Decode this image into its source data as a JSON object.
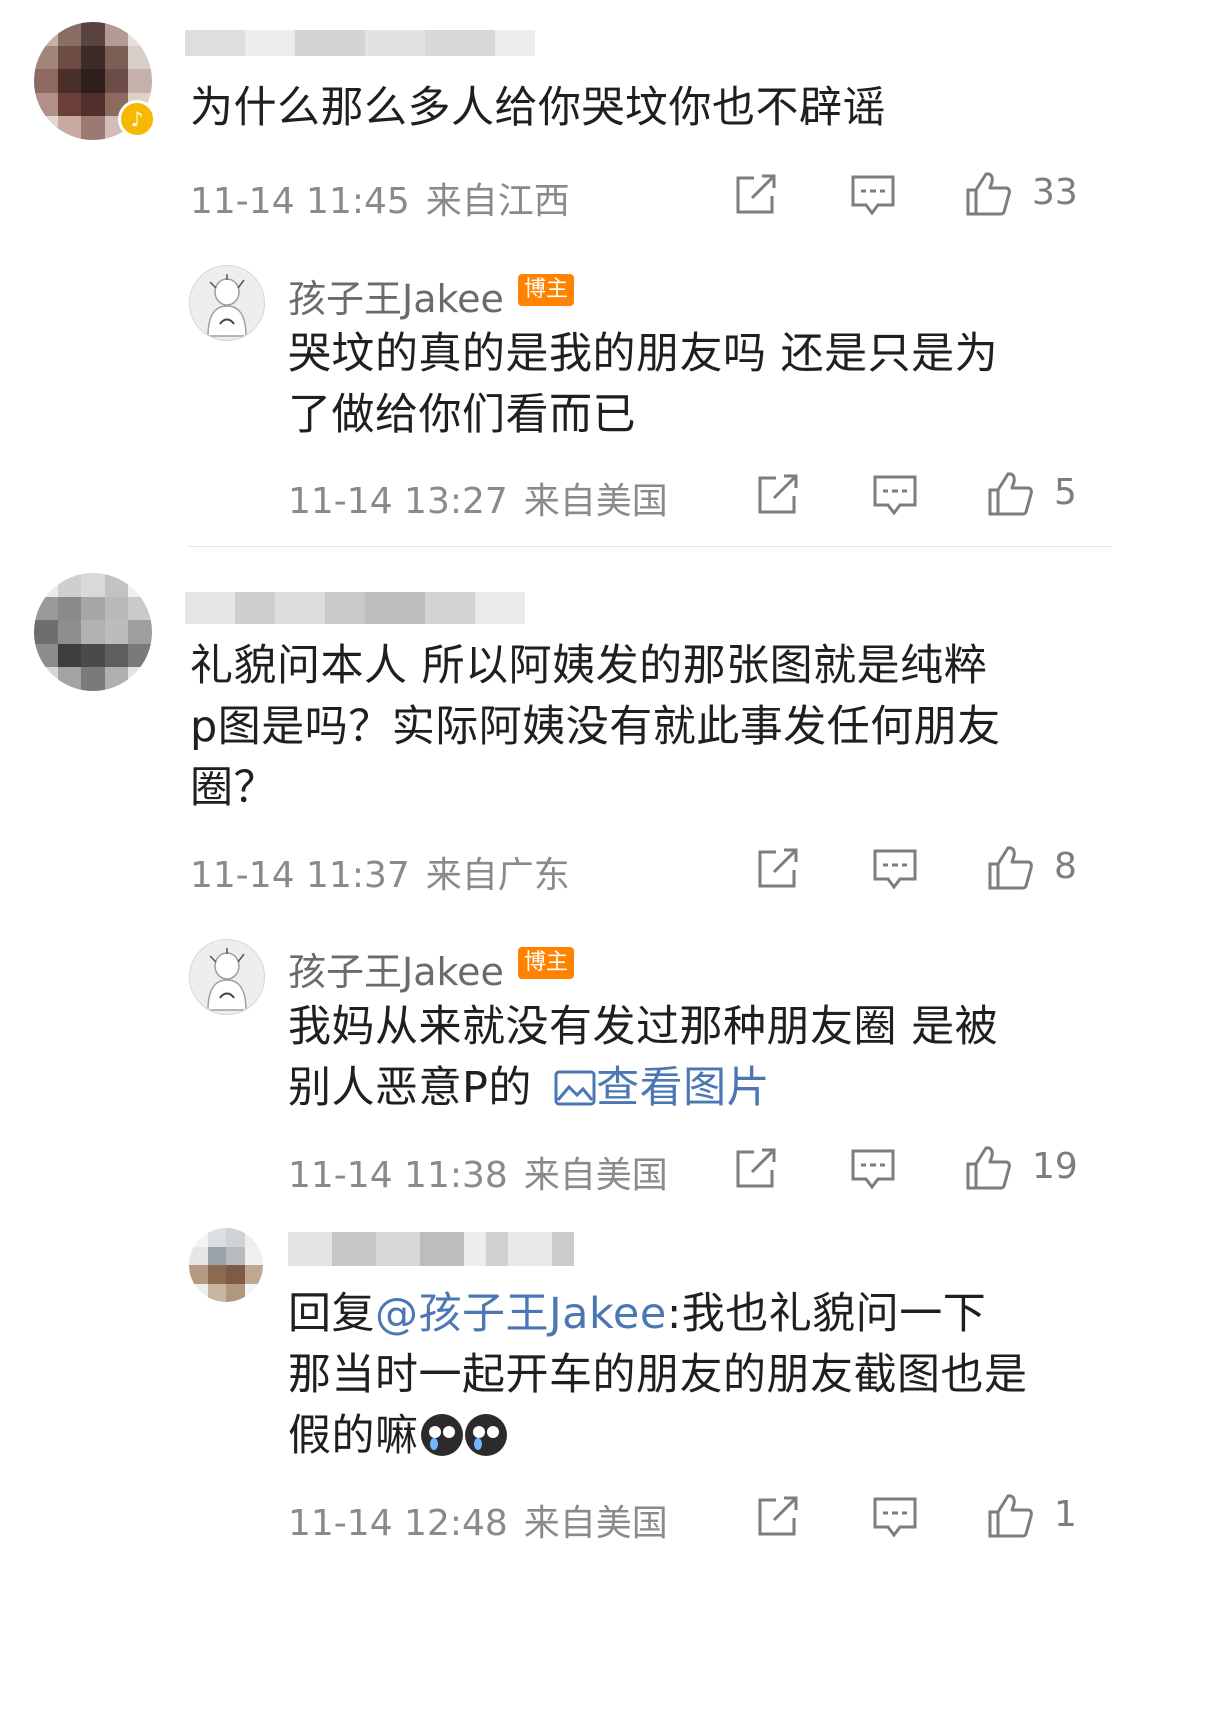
{
  "comments": [
    {
      "text": "为什么那么多人给你哭坟你也不辟谣",
      "time": "11-14 11:45",
      "location": "来自江西",
      "likes": "33",
      "reply": {
        "username": "孩子王Jakee",
        "tag": "博主",
        "text_line1": "哭坟的真的是我的朋友吗 还是只是为",
        "text_line2": "了做给你们看而已",
        "time": "11-14 13:27",
        "location": "来自美国",
        "likes": "5"
      }
    },
    {
      "text_line1": "礼貌问本人 所以阿姨发的那张图就是纯粹",
      "text_line2": "p图是吗？实际阿姨没有就此事发任何朋友",
      "text_line3": "圈？",
      "time": "11-14 11:37",
      "location": "来自广东",
      "likes": "8",
      "reply": {
        "username": "孩子王Jakee",
        "tag": "博主",
        "text_line1": "我妈从来就没有发过那种朋友圈 是被",
        "text_line2": "别人恶意P的",
        "image_link": "查看图片",
        "time": "11-14 11:38",
        "location": "来自美国",
        "likes": "19"
      },
      "reply2": {
        "prefix": "回复",
        "mention": "@孩子王Jakee",
        "text_line1": ":我也礼貌问一下",
        "text_line2": "那当时一起开车的朋友的朋友截图也是",
        "text_line3": "假的嘛",
        "time": "11-14 12:48",
        "location": "来自美国",
        "likes": "1"
      }
    }
  ],
  "icons": [
    "share-icon",
    "comment-icon",
    "like-icon",
    "image-icon",
    "crying-emoji-icon"
  ],
  "colors": {
    "link": "#4b78b4",
    "tag_bg": "#ff8200",
    "meta": "#8a8a8a"
  }
}
